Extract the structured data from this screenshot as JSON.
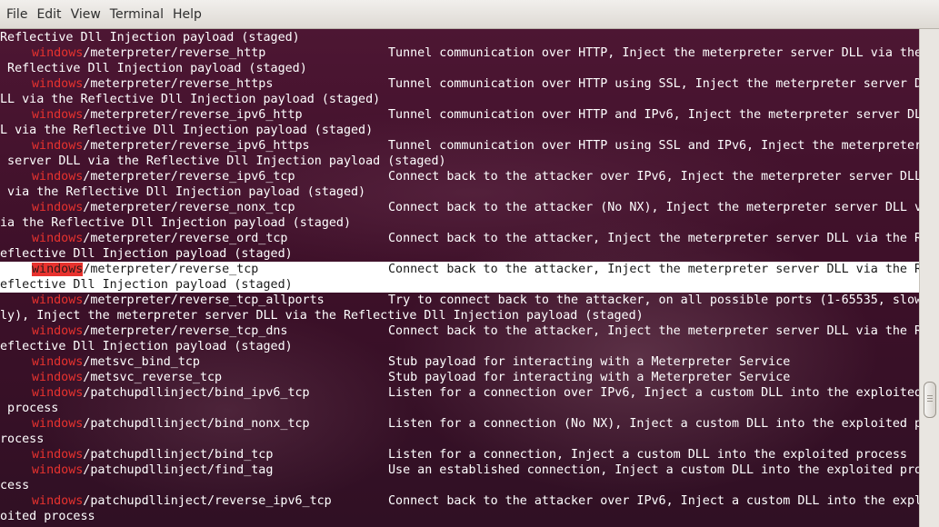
{
  "menu": [
    "File",
    "Edit",
    "View",
    "Terminal",
    "Help"
  ],
  "selected_payload": "windows/meterpreter/reverse_tcp",
  "lines": [
    {
      "text": "Reflective Dll Injection payload (staged)"
    },
    {
      "prefix": "windows",
      "name": "/meterpreter/reverse_http",
      "desc": "Tunnel communication over HTTP, Inject the meterpreter server DLL via the"
    },
    {
      "text": " Reflective Dll Injection payload (staged)"
    },
    {
      "prefix": "windows",
      "name": "/meterpreter/reverse_https",
      "desc": "Tunnel communication over HTTP using SSL, Inject the meterpreter server D"
    },
    {
      "text": "LL via the Reflective Dll Injection payload (staged)"
    },
    {
      "prefix": "windows",
      "name": "/meterpreter/reverse_ipv6_http",
      "desc": "Tunnel communication over HTTP and IPv6, Inject the meterpreter server DL"
    },
    {
      "text": "L via the Reflective Dll Injection payload (staged)"
    },
    {
      "prefix": "windows",
      "name": "/meterpreter/reverse_ipv6_https",
      "desc": "Tunnel communication over HTTP using SSL and IPv6, Inject the meterpreter"
    },
    {
      "text": " server DLL via the Reflective Dll Injection payload (staged)"
    },
    {
      "prefix": "windows",
      "name": "/meterpreter/reverse_ipv6_tcp",
      "desc": "Connect back to the attacker over IPv6, Inject the meterpreter server DLL"
    },
    {
      "text": " via the Reflective Dll Injection payload (staged)"
    },
    {
      "prefix": "windows",
      "name": "/meterpreter/reverse_nonx_tcp",
      "desc": "Connect back to the attacker (No NX), Inject the meterpreter server DLL v"
    },
    {
      "text": "ia the Reflective Dll Injection payload (staged)"
    },
    {
      "prefix": "windows",
      "name": "/meterpreter/reverse_ord_tcp",
      "desc": "Connect back to the attacker, Inject the meterpreter server DLL via the R"
    },
    {
      "text": "eflective Dll Injection payload (staged)"
    },
    {
      "prefix": "windows",
      "name": "/meterpreter/reverse_tcp",
      "desc": "Connect back to the attacker, Inject the meterpreter server DLL via the R",
      "selected": true
    },
    {
      "text": "eflective Dll Injection payload (staged)",
      "selected": true
    },
    {
      "prefix": "windows",
      "name": "/meterpreter/reverse_tcp_allports",
      "desc": "Try to connect back to the attacker, on all possible ports (1-65535, slow"
    },
    {
      "text": "ly), Inject the meterpreter server DLL via the Reflective Dll Injection payload (staged)"
    },
    {
      "prefix": "windows",
      "name": "/meterpreter/reverse_tcp_dns",
      "desc": "Connect back to the attacker, Inject the meterpreter server DLL via the R"
    },
    {
      "text": "eflective Dll Injection payload (staged)"
    },
    {
      "prefix": "windows",
      "name": "/metsvc_bind_tcp",
      "desc": "Stub payload for interacting with a Meterpreter Service"
    },
    {
      "prefix": "windows",
      "name": "/metsvc_reverse_tcp",
      "desc": "Stub payload for interacting with a Meterpreter Service"
    },
    {
      "prefix": "windows",
      "name": "/patchupdllinject/bind_ipv6_tcp",
      "desc": "Listen for a connection over IPv6, Inject a custom DLL into the exploited"
    },
    {
      "text": " process"
    },
    {
      "prefix": "windows",
      "name": "/patchupdllinject/bind_nonx_tcp",
      "desc": "Listen for a connection (No NX), Inject a custom DLL into the exploited p"
    },
    {
      "text": "rocess"
    },
    {
      "prefix": "windows",
      "name": "/patchupdllinject/bind_tcp",
      "desc": "Listen for a connection, Inject a custom DLL into the exploited process"
    },
    {
      "prefix": "windows",
      "name": "/patchupdllinject/find_tag",
      "desc": "Use an established connection, Inject a custom DLL into the exploited pro"
    },
    {
      "text": "cess"
    },
    {
      "prefix": "windows",
      "name": "/patchupdllinject/reverse_ipv6_tcp",
      "desc": "Connect back to the attacker over IPv6, Inject a custom DLL into the expl"
    },
    {
      "text": "oited process"
    }
  ]
}
